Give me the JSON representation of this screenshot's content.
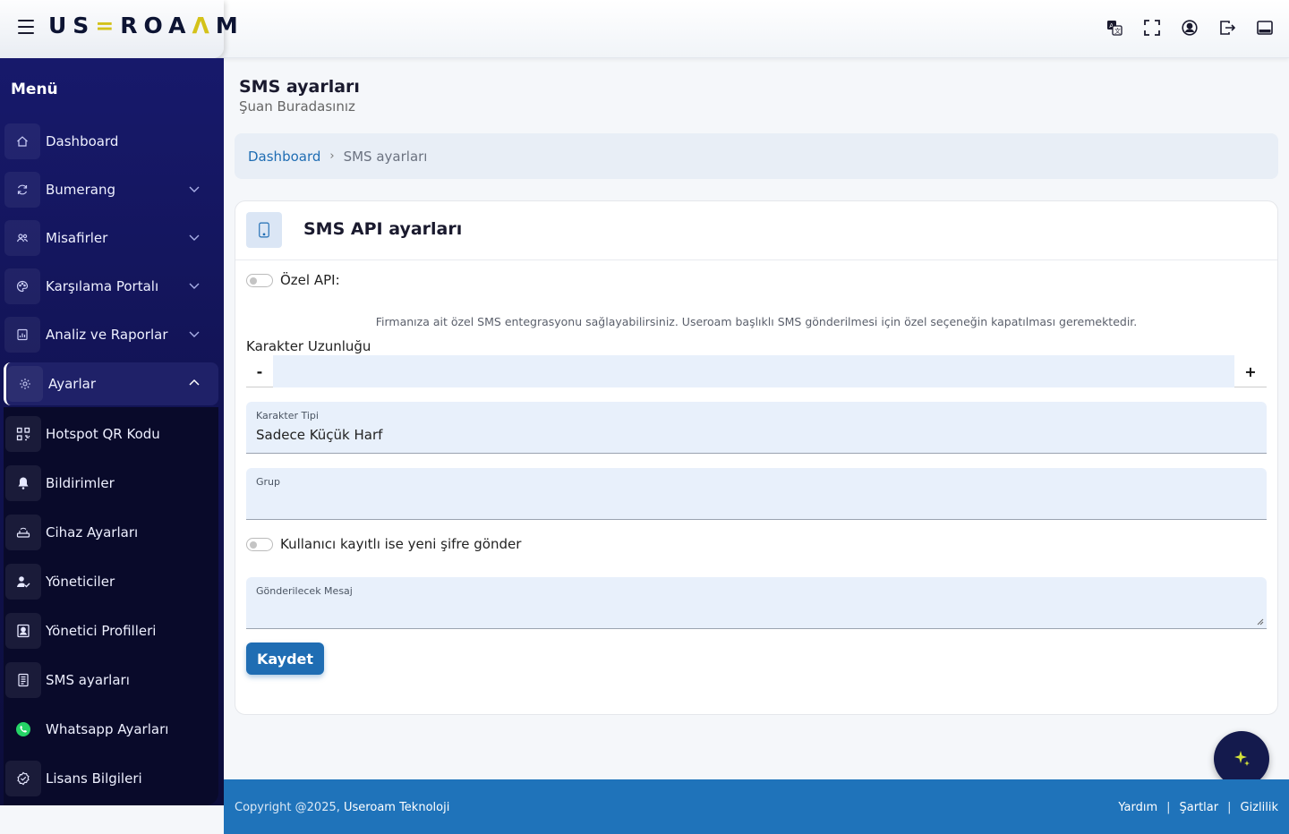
{
  "header": {
    "logo_text_a": "US",
    "logo_text_accent": "=",
    "logo_text_b": "ROA",
    "logo_text_accent2": "Λ",
    "logo_text_c": "M",
    "icons": [
      "translate-icon",
      "fullscreen-icon",
      "user-icon",
      "logout-icon",
      "panel-icon"
    ]
  },
  "sidebar": {
    "title": "Menü",
    "items": [
      {
        "label": "Dashboard",
        "icon": "home-icon"
      },
      {
        "label": "Bumerang",
        "icon": "refresh-icon"
      },
      {
        "label": "Misafirler",
        "icon": "users-icon"
      },
      {
        "label": "Karşılama Portalı",
        "icon": "palette-icon"
      },
      {
        "label": "Analiz ve Raporlar",
        "icon": "chart-icon"
      },
      {
        "label": "Ayarlar",
        "icon": "gear-icon"
      }
    ],
    "subitems": [
      {
        "label": "Hotspot QR Kodu",
        "icon": "qr-icon"
      },
      {
        "label": "Bildirimler",
        "icon": "bell-icon"
      },
      {
        "label": "Cihaz Ayarları",
        "icon": "router-icon"
      },
      {
        "label": "Yöneticiler",
        "icon": "admin-icon"
      },
      {
        "label": "Yönetici Profilleri",
        "icon": "profile-icon"
      },
      {
        "label": "SMS ayarları",
        "icon": "sms-icon"
      },
      {
        "label": "Whatsapp Ayarları",
        "icon": "whatsapp-icon"
      },
      {
        "label": "Lisans Bilgileri",
        "icon": "license-icon"
      }
    ]
  },
  "page": {
    "title": "SMS ayarları",
    "subtitle": "Şuan Buradasınız"
  },
  "breadcrumb": {
    "home": "Dashboard",
    "separator": "›",
    "current": "SMS ayarları"
  },
  "card": {
    "title": "SMS API ayarları",
    "custom_api_label": "Özel API:",
    "help_text": "Firmanıza ait özel SMS entegrasyonu sağlayabilirsiniz. Useroam başlıklı SMS gönderilmesi için özel seçeneğin kapatılması geremektedir.",
    "char_length_label": "Karakter Uzunluğu",
    "minus": "-",
    "plus": "+",
    "char_length_value": "",
    "char_type_label": "Karakter Tipi",
    "char_type_value": "Sadece Küçük Harf",
    "group_label": "Grup",
    "group_value": "",
    "resend_label": "Kullanıcı kayıtlı ise yeni şifre gönder",
    "message_label": "Gönderilecek Mesaj",
    "message_value": "",
    "save_label": "Kaydet"
  },
  "footer": {
    "copyright": "Copyright @2025, ",
    "company": "Useroam Teknoloji",
    "help": "Yardım",
    "terms": "Şartlar",
    "privacy": "Gizlilik",
    "sep": "|"
  },
  "colors": {
    "primary": "#1f6db3",
    "sidebar_top": "#17196b",
    "sidebar_bottom": "#0c0d3a",
    "footer": "#1f73ba",
    "logo_accent": "#d4c21a"
  }
}
